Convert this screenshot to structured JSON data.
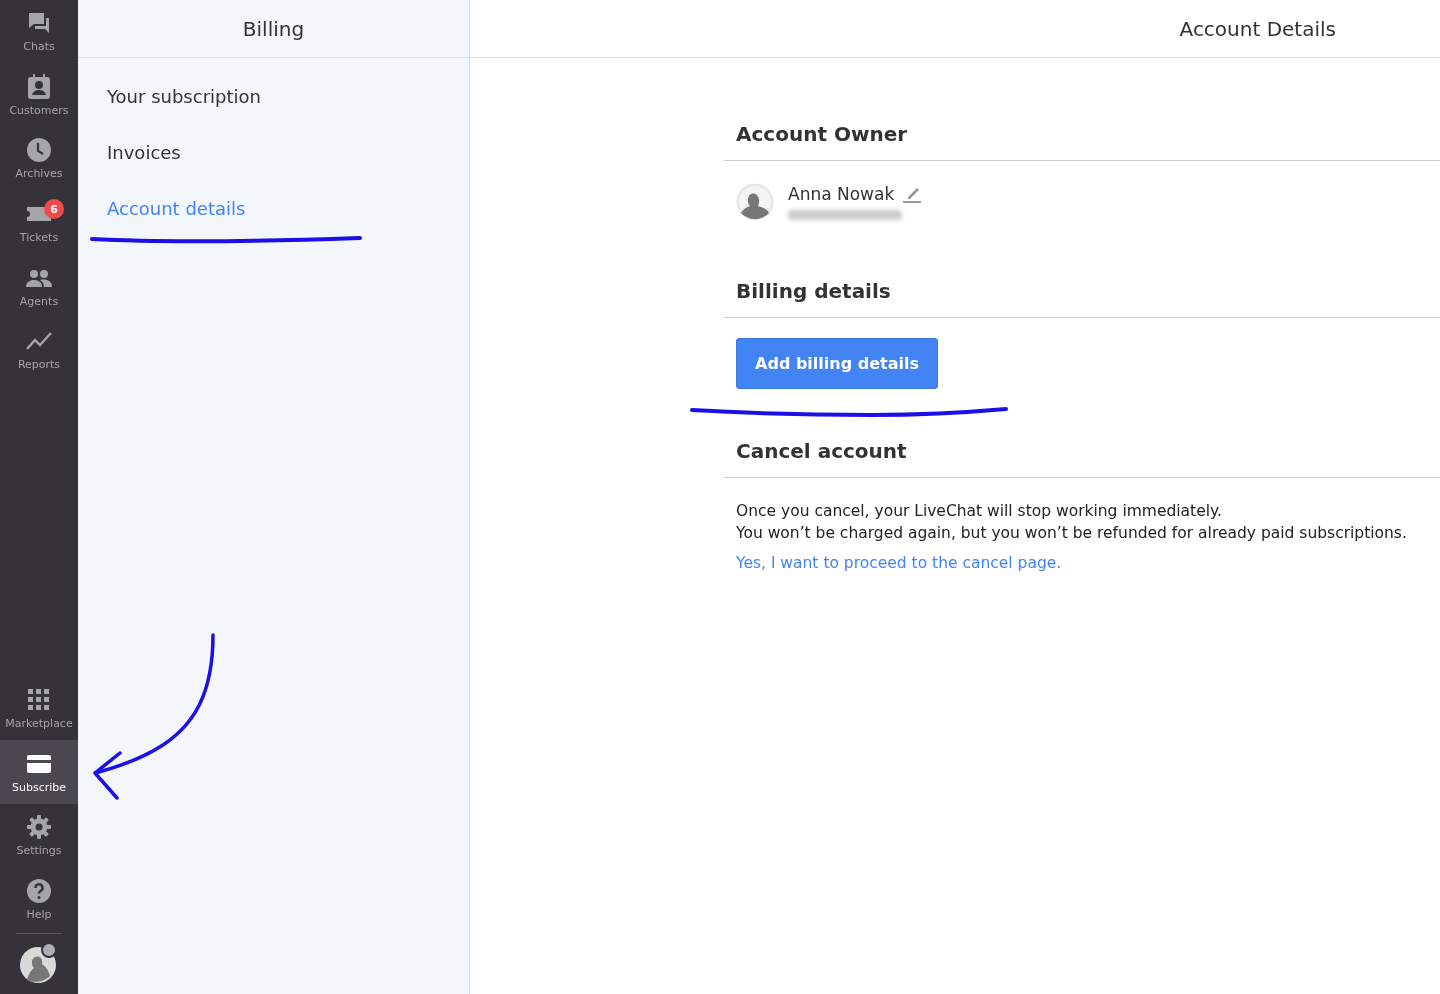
{
  "nav": {
    "items": [
      {
        "kind": "chats",
        "label": "Chats",
        "selected": false
      },
      {
        "kind": "customers",
        "label": "Customers",
        "selected": false
      },
      {
        "kind": "archives",
        "label": "Archives",
        "selected": false
      },
      {
        "kind": "tickets",
        "label": "Tickets",
        "selected": false,
        "badge": "6"
      },
      {
        "kind": "agents",
        "label": "Agents",
        "selected": false
      },
      {
        "kind": "reports",
        "label": "Reports",
        "selected": false
      }
    ],
    "bottom_items": [
      {
        "kind": "marketplace",
        "label": "Marketplace",
        "selected": false
      },
      {
        "kind": "subscribe",
        "label": "Subscribe",
        "selected": true
      },
      {
        "kind": "settings",
        "label": "Settings",
        "selected": false
      },
      {
        "kind": "help",
        "label": "Help",
        "selected": false
      }
    ]
  },
  "billing": {
    "title": "Billing",
    "items": [
      {
        "label": "Your subscription",
        "selected": false
      },
      {
        "label": "Invoices",
        "selected": false
      },
      {
        "label": "Account details",
        "selected": true
      }
    ]
  },
  "details": {
    "title": "Account Details",
    "owner": {
      "heading": "Account Owner",
      "name": "Anna Nowak"
    },
    "billing": {
      "heading": "Billing details",
      "button": "Add billing details"
    },
    "cancel": {
      "heading": "Cancel account",
      "lines": [
        "Once you cancel, your LiveChat will stop working immediately.",
        "You won’t be charged again, but you won’t be refunded for already paid subscriptions."
      ],
      "link": "Yes, I want to proceed to the cancel page."
    }
  }
}
